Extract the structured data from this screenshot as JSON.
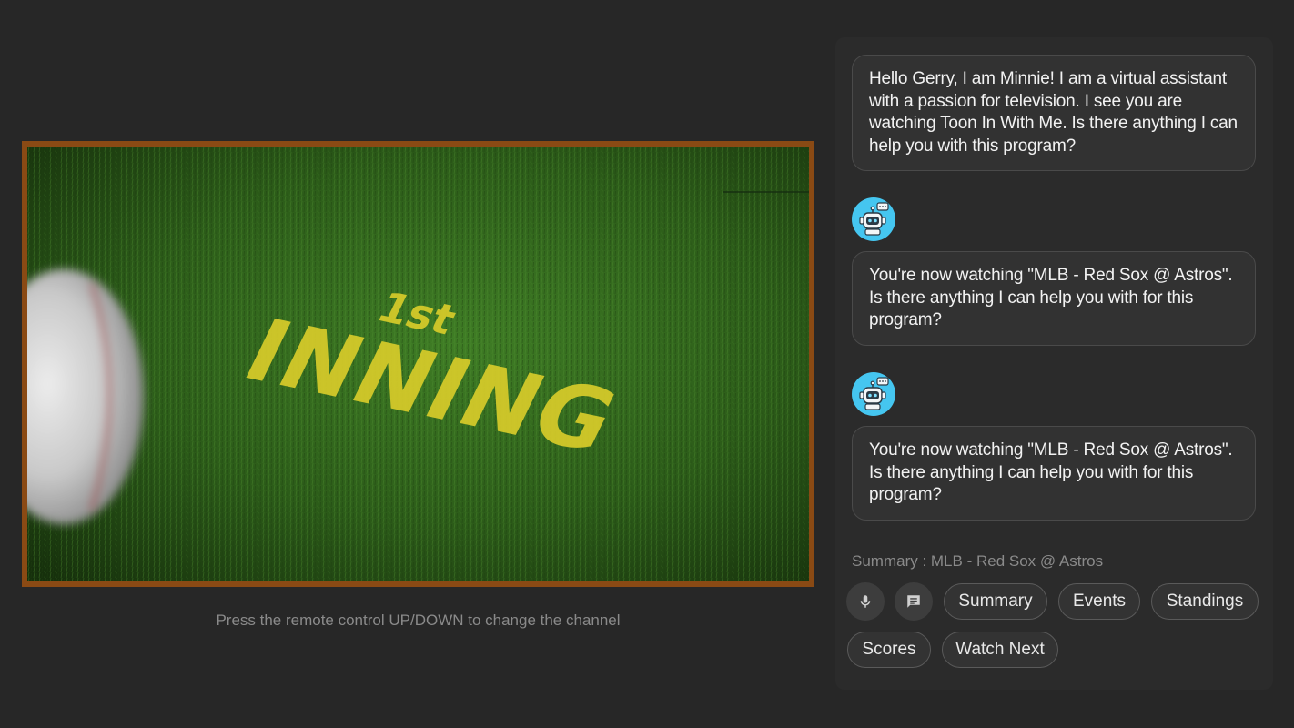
{
  "video": {
    "hint": "Press the remote control UP/DOWN to change the channel",
    "graphic_line1": "1st",
    "graphic_line2": "INNING"
  },
  "assistant": {
    "messages": [
      "Hello Gerry, I am Minnie! I am a virtual assistant with a passion for television. I see you are watching Toon In With Me. Is there anything I can help you with this program?",
      "You're now watching \"MLB - Red Sox @ Astros\". Is there anything I can help you with for this program?",
      "You're now watching \"MLB - Red Sox @ Astros\". Is there anything I can help you with for this program?"
    ],
    "summary_label": "Summary : MLB - Red Sox @ Astros",
    "chips": [
      "Summary",
      "Events",
      "Standings",
      "Scores",
      "Watch Next"
    ],
    "icons": [
      "mic-icon",
      "chat-icon",
      "robot-avatar-icon"
    ]
  },
  "colors": {
    "background": "#272727",
    "panel": "#2b2b2b",
    "video_border": "#8a4a14",
    "avatar": "#45c6f0"
  }
}
